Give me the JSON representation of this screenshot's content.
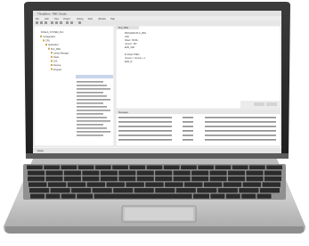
{
  "ide": {
    "window_title": "ThingWorx - RBC Studio",
    "menu_items": [
      "File",
      "Edit",
      "View",
      "Project",
      "Debug",
      "Tools",
      "Window",
      "Help"
    ],
    "tree_root": "FINALS_SYSTEM_PLC",
    "tree_items": [
      "Configuration",
      "CPU",
      "Application",
      "PLC_PRG",
      "Library Manager",
      "Tasks",
      "GVL",
      "Devices",
      "Program"
    ],
    "editor_lines": [
      "PROGRAM PLC_PRG",
      "VAR",
      "  bStart : BOOL;",
      "  nCount : INT;",
      "END_VAR",
      "",
      "IF bStart THEN",
      "  nCount := nCount + 1;",
      "END_IF"
    ],
    "editor_tab": "PLC_PRG",
    "messages_title": "Messages",
    "status_bar": "Ready"
  }
}
